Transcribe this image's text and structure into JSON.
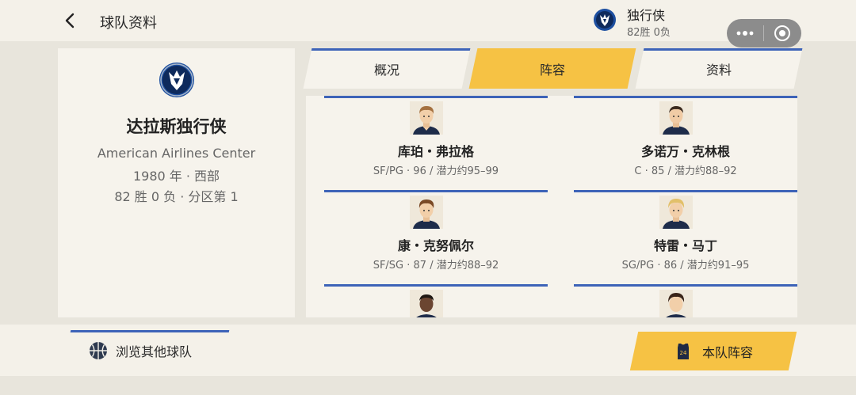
{
  "header": {
    "title": "球队资料",
    "team_short": "独行侠",
    "team_record": "82胜 0负"
  },
  "team": {
    "name": "达拉斯独行侠",
    "arena": "American Airlines Center",
    "founded_conf": "1980 年 · 西部",
    "record_rank": "82 胜 0 负 · 分区第 1"
  },
  "tabs": [
    {
      "label": "概况",
      "active": false
    },
    {
      "label": "阵容",
      "active": true
    },
    {
      "label": "资料",
      "active": false
    }
  ],
  "players": [
    {
      "name": "库珀・弗拉格",
      "info": "SF/PG · 96 / 潜力约95–99"
    },
    {
      "name": "多诺万・克林根",
      "info": "C · 85 / 潜力约88–92"
    },
    {
      "name": "康・克努佩尔",
      "info": "SF/SG · 87 / 潜力约88–92"
    },
    {
      "name": "特雷・马丁",
      "info": "SG/PG · 86 / 潜力约91–95"
    },
    {
      "name": "",
      "info": ""
    },
    {
      "name": "",
      "info": ""
    }
  ],
  "footer": {
    "browse_label": "浏览其他球队",
    "roster_label": "本队阵容"
  },
  "colors": {
    "accent_blue": "#3d63b8",
    "accent_yellow": "#f6c244",
    "card_bg": "#f6f3ec",
    "page_bg": "#e8e5dc"
  },
  "icons": [
    "back-icon",
    "mavericks-logo-icon",
    "more-dots-icon",
    "target-icon",
    "basketball-icon",
    "jersey-icon"
  ]
}
